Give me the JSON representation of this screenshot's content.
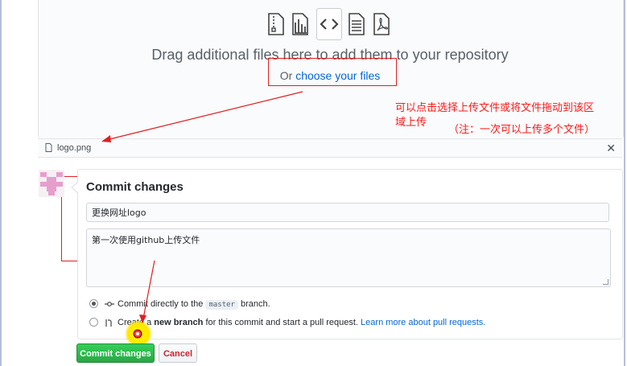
{
  "upload": {
    "drag_text": "Drag additional files here to add them to your repository",
    "choose_prefix": "Or ",
    "choose_link": "choose your files",
    "icons": [
      "zip-file-icon",
      "chart-file-icon",
      "code-file-icon",
      "text-file-icon",
      "pdf-file-icon"
    ]
  },
  "annotation": {
    "line1": "可以点击选择上传文件或将文件拖动到该区",
    "line2": "域上传",
    "line3": "（注：一次可以上传多个文件）",
    "color": "#ff1a1a"
  },
  "file_list": [
    {
      "name": "logo.png",
      "remove_glyph": "✕"
    }
  ],
  "commit": {
    "title": "Commit changes",
    "summary_value": "更换网址logo",
    "description_value": "第一次使用github上传文件",
    "option_direct": {
      "prefix": "Commit directly to the",
      "branch": "master",
      "suffix": "branch.",
      "selected": true
    },
    "option_new_branch": {
      "prefix": "Create a",
      "bold": "new branch",
      "middle": "for this commit and start a pull request.",
      "link": "Learn more about pull requests.",
      "selected": false
    },
    "commit_button": "Commit changes",
    "cancel_button": "Cancel"
  },
  "colors": {
    "accent_link": "#0366d6",
    "commit_green": "#28a745",
    "cancel_red": "#cb2431",
    "annotation_red": "#e02020"
  }
}
